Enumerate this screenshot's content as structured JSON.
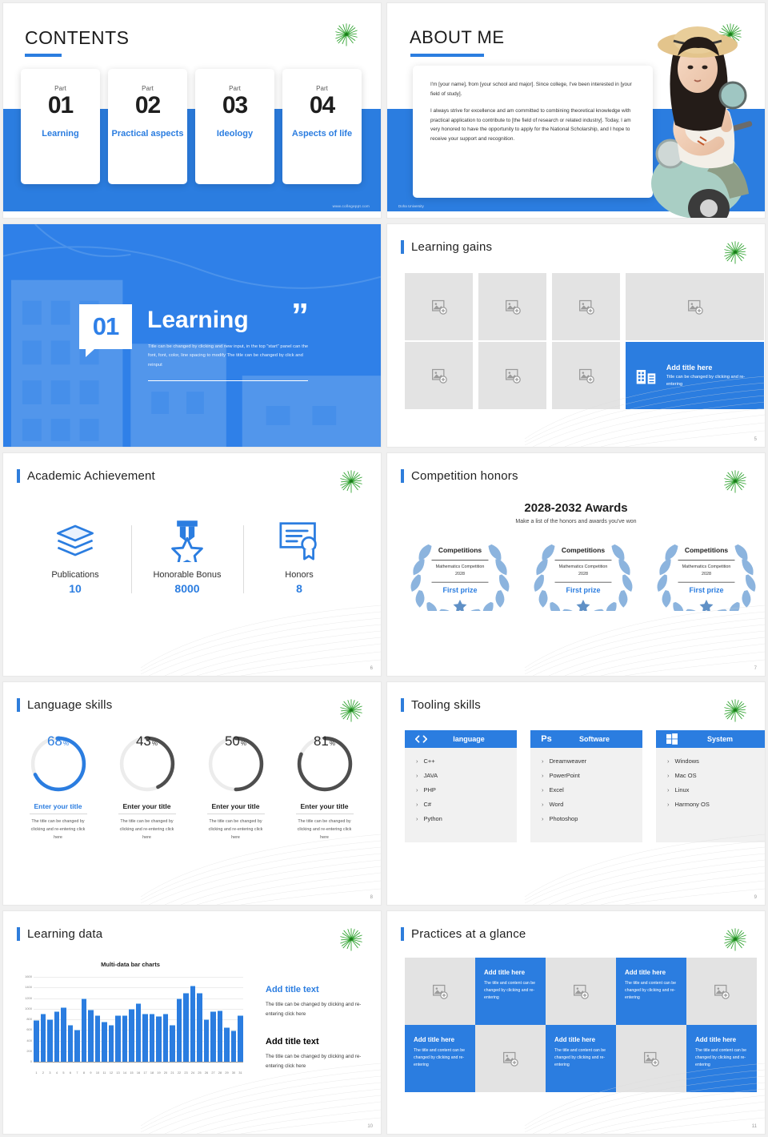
{
  "brand": {
    "blue": "#2b7de0",
    "gray": "#e3e3e3",
    "green": "#2aa02a"
  },
  "slide1": {
    "title": "CONTENTS",
    "part_label": "Part",
    "cards": [
      {
        "num": "01",
        "label": "Learning"
      },
      {
        "num": "02",
        "label": "Practical aspects"
      },
      {
        "num": "03",
        "label": "Ideology"
      },
      {
        "num": "04",
        "label": "Aspects of life"
      }
    ],
    "footer": "www.collegeppt.com"
  },
  "slide2": {
    "title": "ABOUT ME",
    "paragraphs": [
      "I'm [your name], from [your school and major]. Since college, I've been interested in [your field of study].",
      "I always strive for excellence and am committed to combining theoretical knowledge with practical application to contribute to [the field of research or related industry]. Today, I am very honored to have the opportunity to apply for the National Scholarship, and I hope to receive your support and recognition."
    ],
    "footer": "Doha University"
  },
  "slide3": {
    "number": "01",
    "title": "Learning",
    "quote_mark": "”",
    "description": "Title can be changed by clicking and new input, in the top \"start\" panel can the font, font, color, line spacing to modify The title can be changed by click and reinput"
  },
  "slide4": {
    "title": "Learning gains",
    "card": {
      "title": "Add title here",
      "desc": "Title can be changed by clicking and re-entering",
      "icon": "building-icon"
    },
    "page": "5"
  },
  "slide5": {
    "title": "Academic Achievement",
    "stats": [
      {
        "name": "Publications",
        "value": "10",
        "icon": "books-icon"
      },
      {
        "name": "Honorable Bonus",
        "value": "8000",
        "icon": "medal-icon"
      },
      {
        "name": "Honors",
        "value": "8",
        "icon": "certificate-icon"
      }
    ],
    "page": "6"
  },
  "slide6": {
    "title": "Competition honors",
    "awards_title": "2028-2032 Awards",
    "awards_subtitle": "Make a list of the honors and awards you've won",
    "wreaths": [
      {
        "heading": "Competitions",
        "line1": "Mathematics Competition",
        "line2": "2028",
        "prize": "First prize"
      },
      {
        "heading": "Competitions",
        "line1": "Mathematics Competition",
        "line2": "2028",
        "prize": "First prize"
      },
      {
        "heading": "Competitions",
        "line1": "Mathematics Competition",
        "line2": "2028",
        "prize": "First prize"
      }
    ],
    "page": "7"
  },
  "slide7": {
    "title": "Language skills",
    "items": [
      {
        "percent": "68",
        "unit": "%",
        "title": "Enter your title",
        "desc": "The title can be changed by clicking and re-entering click here",
        "accent": "#2b7de0"
      },
      {
        "percent": "43",
        "unit": "%",
        "title": "Enter your title",
        "desc": "The title can be changed by clicking and re-entering click here",
        "accent": "#4e4e4e"
      },
      {
        "percent": "50",
        "unit": "%",
        "title": "Enter your title",
        "desc": "The title can be changed by clicking and re-entering click here",
        "accent": "#4e4e4e"
      },
      {
        "percent": "81",
        "unit": "%",
        "title": "Enter your title",
        "desc": "The title can be changed by clicking and re-entering click here",
        "accent": "#4e4e4e"
      }
    ],
    "page": "8"
  },
  "slide8": {
    "title": "Tooling skills",
    "columns": [
      {
        "icon": "code-icon",
        "name": "language",
        "items": [
          "C++",
          "JAVA",
          "PHP",
          "C#",
          "Python"
        ]
      },
      {
        "icon": "photoshop-icon",
        "name": "Software",
        "items": [
          "Dreamweaver",
          "PowerPoint",
          "Excel",
          "Word",
          "Photoshop"
        ]
      },
      {
        "icon": "windows-icon",
        "name": "System",
        "items": [
          "Windows",
          "Mac OS",
          "Linux",
          "Harmony OS"
        ]
      }
    ],
    "page": "9"
  },
  "slide9": {
    "title": "Learning data",
    "blocks": [
      {
        "heading": "Add title text",
        "text": "The title can be changed by clicking and re-entering click here"
      },
      {
        "heading": "Add title text",
        "text": "The title can be changed by clicking and re-entering click here"
      }
    ],
    "page": "10",
    "chart_data": {
      "type": "bar",
      "title": "Multi-data bar charts",
      "xlabel": "",
      "ylabel": "",
      "ylim": [
        0,
        1600
      ],
      "yticks": [
        0,
        200,
        400,
        600,
        800,
        1000,
        1200,
        1400,
        1600
      ],
      "grid": true,
      "legend": "none",
      "categories": [
        "1",
        "2",
        "3",
        "4",
        "5",
        "6",
        "7",
        "8",
        "9",
        "10",
        "11",
        "12",
        "13",
        "14",
        "15",
        "16",
        "17",
        "18",
        "19",
        "20",
        "21",
        "22",
        "23",
        "24",
        "25",
        "26",
        "27",
        "28",
        "29",
        "30",
        "31"
      ],
      "values": [
        790,
        900,
        800,
        950,
        1020,
        700,
        600,
        1200,
        980,
        880,
        760,
        700,
        880,
        880,
        990,
        1100,
        900,
        900,
        860,
        900,
        700,
        1200,
        1300,
        1440,
        1300,
        800,
        950,
        970,
        650,
        590,
        870
      ]
    }
  },
  "slide10": {
    "title": "Practices at a glance",
    "card": {
      "title": "Add title here",
      "desc": "The title and content can be changed by clicking and re-entering"
    },
    "cells": [
      "img",
      "blue",
      "img",
      "blue",
      "img",
      "blue",
      "img",
      "blue",
      "img",
      "blue"
    ],
    "page": "11"
  }
}
